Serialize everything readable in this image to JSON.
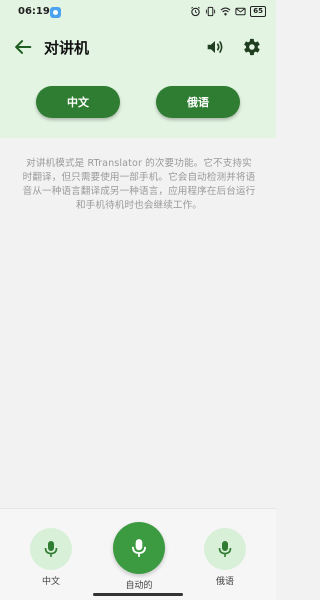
{
  "status_bar": {
    "time": "06:19",
    "battery": "65",
    "icons": [
      "alarm-icon",
      "vibrate-icon",
      "wifi-icon",
      "mail-icon",
      "battery-icon"
    ]
  },
  "app_bar": {
    "title": "对讲机",
    "icons": [
      "back-arrow-icon",
      "speaker-icon",
      "gear-icon"
    ]
  },
  "languages": {
    "left": "中文",
    "right": "俄语"
  },
  "description": "对讲机模式是 RTranslator 的次要功能。它不支持实时翻译，但只需要使用一部手机。它会自动检测并将语音从一种语言翻译成另一种语言，应用程序在后台运行和手机待机时也会继续工作。",
  "bottom": {
    "left_label": "中文",
    "center_label": "自动的",
    "right_label": "俄语"
  },
  "colors": {
    "accent": "#2f7d32",
    "header_bg": "#e3f4e3",
    "mic_light_bg": "#d8efd8",
    "mic_center_bg": "#3c9b40"
  }
}
